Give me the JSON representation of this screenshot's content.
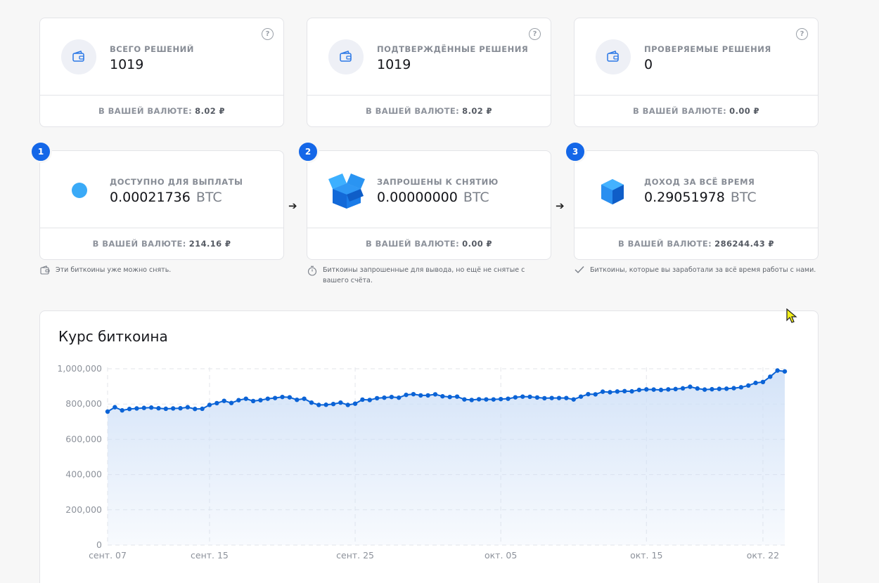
{
  "top_cards": [
    {
      "label": "ВСЕГО РЕШЕНИЙ",
      "value": "1019",
      "currency_label": "В ВАШЕЙ ВАЛЮТЕ:",
      "currency_value": "8.02 ₽",
      "icon": "wallet-icon"
    },
    {
      "label": "ПОДТВЕРЖДЁННЫЕ РЕШЕНИЯ",
      "value": "1019",
      "currency_label": "В ВАШЕЙ ВАЛЮТЕ:",
      "currency_value": "8.02 ₽",
      "icon": "wallet-icon"
    },
    {
      "label": "ПРОВЕРЯЕМЫЕ РЕШЕНИЯ",
      "value": "0",
      "currency_label": "В ВАШЕЙ ВАЛЮТЕ:",
      "currency_value": "0.00 ₽",
      "icon": "wallet-icon"
    }
  ],
  "help_glyph": "?",
  "step_cards": [
    {
      "step": "1",
      "label": "ДОСТУПНО ДЛЯ ВЫПЛАТЫ",
      "value": "0.00021736",
      "unit": "BTC",
      "currency_label": "В ВАШЕЙ ВАЛЮТЕ:",
      "currency_value": "214.16 ₽",
      "icon": "coin-dot-icon",
      "note": "Эти биткоины уже можно снять.",
      "note_icon": "wallet-outline-icon"
    },
    {
      "step": "2",
      "label": "ЗАПРОШЕНЫ К СНЯТИЮ",
      "value": "0.00000000",
      "unit": "BTC",
      "currency_label": "В ВАШЕЙ ВАЛЮТЕ:",
      "currency_value": "0.00 ₽",
      "icon": "open-box-icon",
      "note": "Биткоины запрошенные для вывода, но ещё не снятые с вашего счёта.",
      "note_icon": "stopwatch-icon"
    },
    {
      "step": "3",
      "label": "ДОХОД ЗА ВСЁ ВРЕМЯ",
      "value": "0.29051978",
      "unit": "BTC",
      "currency_label": "В ВАШЕЙ ВАЛЮТЕ:",
      "currency_value": "286244.43 ₽",
      "icon": "cube-icon",
      "note": "Биткоины, которые вы заработали за всё время работы с нами.",
      "note_icon": "check-icon"
    }
  ],
  "arrow_glyph": "➔",
  "colors": {
    "accent": "#1467e8",
    "line": "#0b63d6",
    "fill": "#cfe0f7",
    "dot": "#3aaaf7"
  },
  "chart_title": "Курс биткоина",
  "chart_data": {
    "type": "area",
    "title": "Курс биткоина",
    "ylim": [
      0,
      1000000
    ],
    "y_ticks": [
      "0",
      "200,000",
      "400,000",
      "600,000",
      "800,000",
      "1,000,000"
    ],
    "y_tick_values": [
      0,
      200000,
      400000,
      600000,
      800000,
      1000000
    ],
    "x_ticks": [
      "сент. 07",
      "сент. 15",
      "сент. 25",
      "окт. 05",
      "окт. 15",
      "окт. 22"
    ],
    "x_tick_index": [
      0,
      14,
      34,
      54,
      74,
      90
    ],
    "grid": true,
    "values": [
      757000,
      782000,
      764000,
      772000,
      775000,
      778000,
      780000,
      776000,
      773000,
      775000,
      776000,
      782000,
      772000,
      773000,
      795000,
      805000,
      818000,
      806000,
      822000,
      830000,
      817000,
      822000,
      830000,
      834000,
      840000,
      838000,
      824000,
      830000,
      808000,
      795000,
      796000,
      800000,
      808000,
      795000,
      802000,
      825000,
      823000,
      833000,
      836000,
      840000,
      836000,
      852000,
      856000,
      849000,
      849000,
      855000,
      844000,
      840000,
      842000,
      826000,
      823000,
      827000,
      826000,
      826000,
      828000,
      830000,
      838000,
      842000,
      841000,
      837000,
      833000,
      834000,
      834000,
      834000,
      826000,
      842000,
      856000,
      855000,
      870000,
      867000,
      871000,
      873000,
      872000,
      880000,
      883000,
      882000,
      880000,
      883000,
      885000,
      889000,
      898000,
      888000,
      882000,
      884000,
      886000,
      887000,
      890000,
      895000,
      905000,
      920000,
      925000,
      955000,
      990000,
      985000
    ]
  }
}
